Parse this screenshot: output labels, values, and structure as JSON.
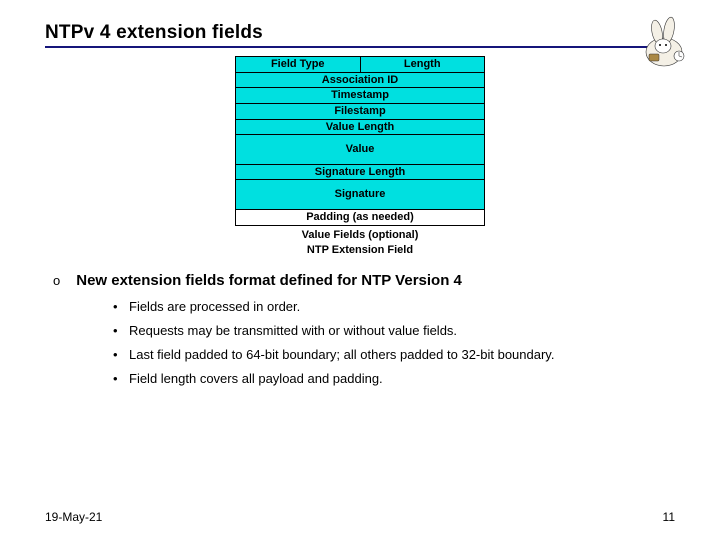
{
  "title": "NTPv 4  extension fields",
  "packet": {
    "row1_left": "Field Type",
    "row1_right": "Length",
    "assoc": "Association ID",
    "timestamp": "Timestamp",
    "filestamp": "Filestamp",
    "value_length": "Value Length",
    "value": "Value",
    "sig_length": "Signature Length",
    "signature": "Signature",
    "padding": "Padding (as needed)"
  },
  "captions": {
    "value_fields": "Value Fields (optional)",
    "ext_field": "NTP Extension Field"
  },
  "lead_marker": "o",
  "lead": "New extension fields format defined for NTP Version 4",
  "bullets": [
    "Fields are processed in order.",
    "Requests may be transmitted with or without value fields.",
    "Last field padded to 64-bit boundary; all others padded to 32-bit boundary.",
    "Field length covers all payload and padding."
  ],
  "footer": {
    "date": "19-May-21",
    "page": "11"
  }
}
